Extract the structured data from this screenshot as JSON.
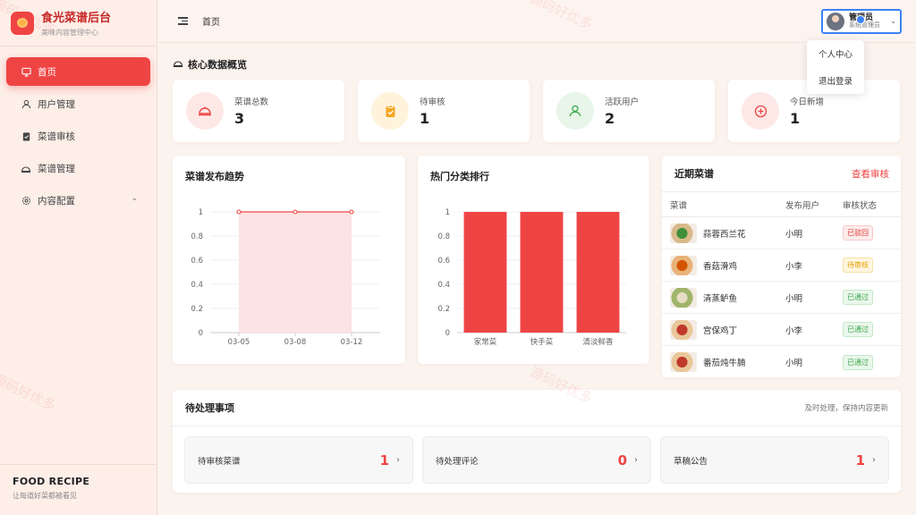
{
  "brand": {
    "title": "食光菜谱后台",
    "subtitle": "美味内容管理中心"
  },
  "sidebar": {
    "items": [
      {
        "label": "首页",
        "icon": "monitor-icon",
        "active": true
      },
      {
        "label": "用户管理",
        "icon": "user-icon"
      },
      {
        "label": "菜谱审核",
        "icon": "clipboard-check-icon"
      },
      {
        "label": "菜谱管理",
        "icon": "dish-icon"
      },
      {
        "label": "内容配置",
        "icon": "gear-icon",
        "has_children": true
      }
    ],
    "footer_title": "FOOD RECIPE",
    "footer_subtitle": "让每道好菜都被看见"
  },
  "header": {
    "breadcrumb": "首页",
    "user_name": "管理员",
    "user_role": "系统管理员",
    "dropdown": [
      "个人中心",
      "退出登录"
    ]
  },
  "overview": {
    "title": "核心数据概览",
    "stats": [
      {
        "label": "菜谱总数",
        "value": "3",
        "icon": "dish-icon",
        "bg": "#fde8e6",
        "fg": "#ef4444"
      },
      {
        "label": "待审核",
        "value": "1",
        "icon": "clipboard-check-icon",
        "bg": "#fff3dc",
        "fg": "#f5a623"
      },
      {
        "label": "活跃用户",
        "value": "2",
        "icon": "user-icon",
        "bg": "#e7f6e9",
        "fg": "#3aa84a"
      },
      {
        "label": "今日新增",
        "value": "1",
        "icon": "plus-circle-icon",
        "bg": "#fde8e6",
        "fg": "#ef4444"
      }
    ]
  },
  "chart_data": [
    {
      "type": "area",
      "title": "菜谱发布趋势",
      "categories": [
        "03-05",
        "03-08",
        "03-12"
      ],
      "values": [
        1,
        1,
        1
      ],
      "ylim": [
        0,
        1
      ],
      "yticks": [
        "0",
        "0.2",
        "0.4",
        "0.6",
        "0.8",
        "1"
      ],
      "grid": true
    },
    {
      "type": "bar",
      "title": "热门分类排行",
      "categories": [
        "家常菜",
        "快手菜",
        "清淡鲜香"
      ],
      "values": [
        1,
        1,
        1
      ],
      "ylim": [
        0,
        1
      ],
      "yticks": [
        "0",
        "0.2",
        "0.4",
        "0.6",
        "0.8",
        "1"
      ],
      "grid": true
    }
  ],
  "recent": {
    "title": "近期菜谱",
    "link": "查看审核",
    "columns": [
      "菜谱",
      "发布用户",
      "审核状态"
    ],
    "rows": [
      {
        "name": "蒜蓉西兰花",
        "user": "小明",
        "status": "已驳回",
        "tone": "red",
        "thumb": "green"
      },
      {
        "name": "香菇滑鸡",
        "user": "小李",
        "status": "待审核",
        "tone": "orange",
        "thumb": "orange"
      },
      {
        "name": "清蒸鲈鱼",
        "user": "小明",
        "status": "已通过",
        "tone": "green",
        "thumb": "fish"
      },
      {
        "name": "宫保鸡丁",
        "user": "小李",
        "status": "已通过",
        "tone": "green",
        "thumb": "red"
      },
      {
        "name": "番茄炖牛腩",
        "user": "小明",
        "status": "已通过",
        "tone": "green",
        "thumb": "red"
      }
    ]
  },
  "todo": {
    "title": "待处理事项",
    "hint": "及时处理，保持内容更新",
    "items": [
      {
        "label": "待审核菜谱",
        "count": "1"
      },
      {
        "label": "待处理评论",
        "count": "0"
      },
      {
        "label": "草稿公告",
        "count": "1"
      }
    ]
  },
  "watermark": "源码好优多",
  "colors": {
    "accent": "#ef4444",
    "bg": "#fbf3ee"
  }
}
